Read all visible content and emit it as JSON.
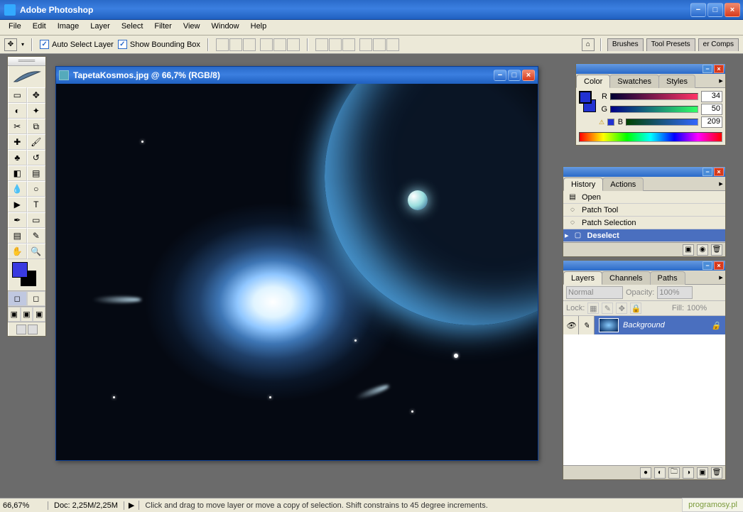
{
  "app": {
    "title": "Adobe Photoshop"
  },
  "menu": {
    "file": "File",
    "edit": "Edit",
    "image": "Image",
    "layer": "Layer",
    "select": "Select",
    "filter": "Filter",
    "view": "View",
    "window": "Window",
    "help": "Help"
  },
  "opt": {
    "auto_select": "Auto Select Layer",
    "show_bbox": "Show Bounding Box",
    "wells": {
      "brushes": "Brushes",
      "toolpresets": "Tool Presets",
      "layercomps": "er Comps"
    }
  },
  "document": {
    "title": "TapetaKosmos.jpg @ 66,7% (RGB/8)"
  },
  "color": {
    "tabs": {
      "color": "Color",
      "swatches": "Swatches",
      "styles": "Styles"
    },
    "r": {
      "label": "R",
      "value": "34"
    },
    "g": {
      "label": "G",
      "value": "50"
    },
    "b": {
      "label": "B",
      "value": "209"
    }
  },
  "history": {
    "tabs": {
      "history": "History",
      "actions": "Actions"
    },
    "items": [
      "Open",
      "Patch Tool",
      "Patch Selection",
      "Deselect"
    ]
  },
  "layers": {
    "tabs": {
      "layers": "Layers",
      "channels": "Channels",
      "paths": "Paths"
    },
    "blend": "Normal",
    "opacity_label": "Opacity:",
    "opacity": "100%",
    "lock_label": "Lock:",
    "fill_label": "Fill:",
    "fill": "100%",
    "bg": "Background"
  },
  "status": {
    "zoom": "66,67%",
    "doc": "Doc: 2,25M/2,25M",
    "hint": "Click and drag to move layer or move a copy of selection. Shift constrains to 45 degree increments."
  },
  "watermark": "programosy.pl"
}
